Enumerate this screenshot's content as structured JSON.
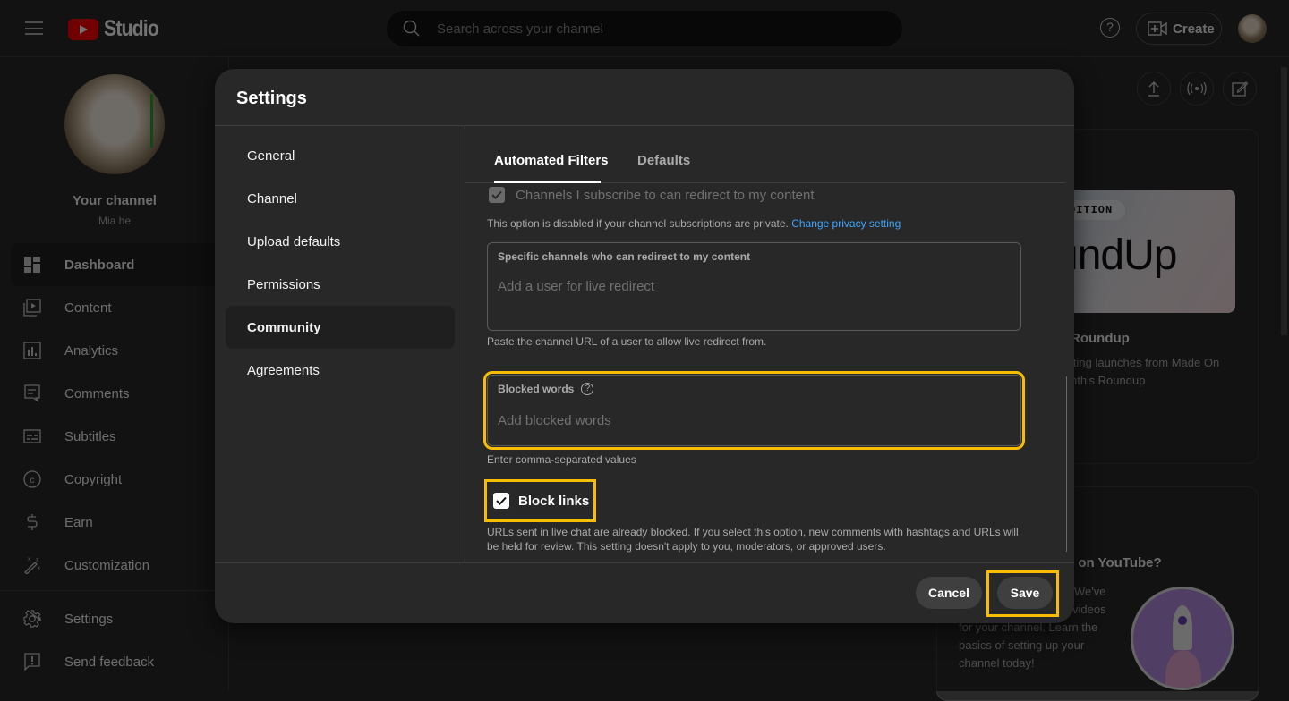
{
  "app": {
    "brand": "Studio",
    "search": {
      "placeholder": "Search across your channel"
    },
    "header": {
      "help_icon": "help-circle-icon",
      "create_label": "Create"
    }
  },
  "sidebar": {
    "channel_title": "Your channel",
    "channel_name": "Mia he",
    "items": [
      {
        "label": "Dashboard",
        "icon": "dashboard-icon",
        "active": true
      },
      {
        "label": "Content",
        "icon": "content-icon"
      },
      {
        "label": "Analytics",
        "icon": "analytics-icon"
      },
      {
        "label": "Comments",
        "icon": "comments-icon"
      },
      {
        "label": "Subtitles",
        "icon": "subtitles-icon"
      },
      {
        "label": "Copyright",
        "icon": "copyright-icon"
      },
      {
        "label": "Earn",
        "icon": "dollar-icon"
      },
      {
        "label": "Customization",
        "icon": "magic-wand-icon"
      }
    ],
    "bottom_items": [
      {
        "label": "Settings",
        "icon": "gear-icon"
      },
      {
        "label": "Send feedback",
        "icon": "feedback-icon"
      }
    ]
  },
  "dashboard": {
    "card1": {
      "thumb_badge": "DITION",
      "thumb_text": "undUp",
      "title": "Roundup",
      "text_line1": "iting launches from Made On",
      "text_line2": "nth's Roundup"
    },
    "card2": {
      "title": "l on YouTube?",
      "text_line1": "We've",
      "text_line2": "videos",
      "text_line3": "for your channel. Learn the",
      "text_line4": "basics of setting up your",
      "text_line5": "channel today!"
    }
  },
  "dialog": {
    "title": "Settings",
    "nav": [
      {
        "label": "General"
      },
      {
        "label": "Channel"
      },
      {
        "label": "Upload defaults"
      },
      {
        "label": "Permissions"
      },
      {
        "label": "Community",
        "active": true
      },
      {
        "label": "Agreements"
      }
    ],
    "tabs": [
      {
        "label": "Automated Filters",
        "active": true
      },
      {
        "label": "Defaults"
      }
    ],
    "subscribe_redirect": {
      "label": "Channels I subscribe to can redirect to my content",
      "checked": true,
      "disabled": true
    },
    "privacy_note": "This option is disabled if your channel subscriptions are private.",
    "privacy_link": "Change privacy setting",
    "specific_channels": {
      "label": "Specific channels who can redirect to my content",
      "placeholder": "Add a user for live redirect",
      "value": "",
      "helper": "Paste the channel URL of a user to allow live redirect from."
    },
    "blocked_words": {
      "label": "Blocked words",
      "placeholder": "Add blocked words",
      "value": "",
      "helper": "Enter comma-separated values"
    },
    "block_links": {
      "label": "Block links",
      "checked": true,
      "description": "URLs sent in live chat are already blocked. If you select this option, new comments with hashtags and URLs will be held for review. This setting doesn't apply to you, moderators, or approved users."
    },
    "buttons": {
      "cancel": "Cancel",
      "save": "Save"
    }
  },
  "colors": {
    "highlight": "#f9bd00",
    "link": "#3ea6ff",
    "brand_red": "#ff0000"
  }
}
